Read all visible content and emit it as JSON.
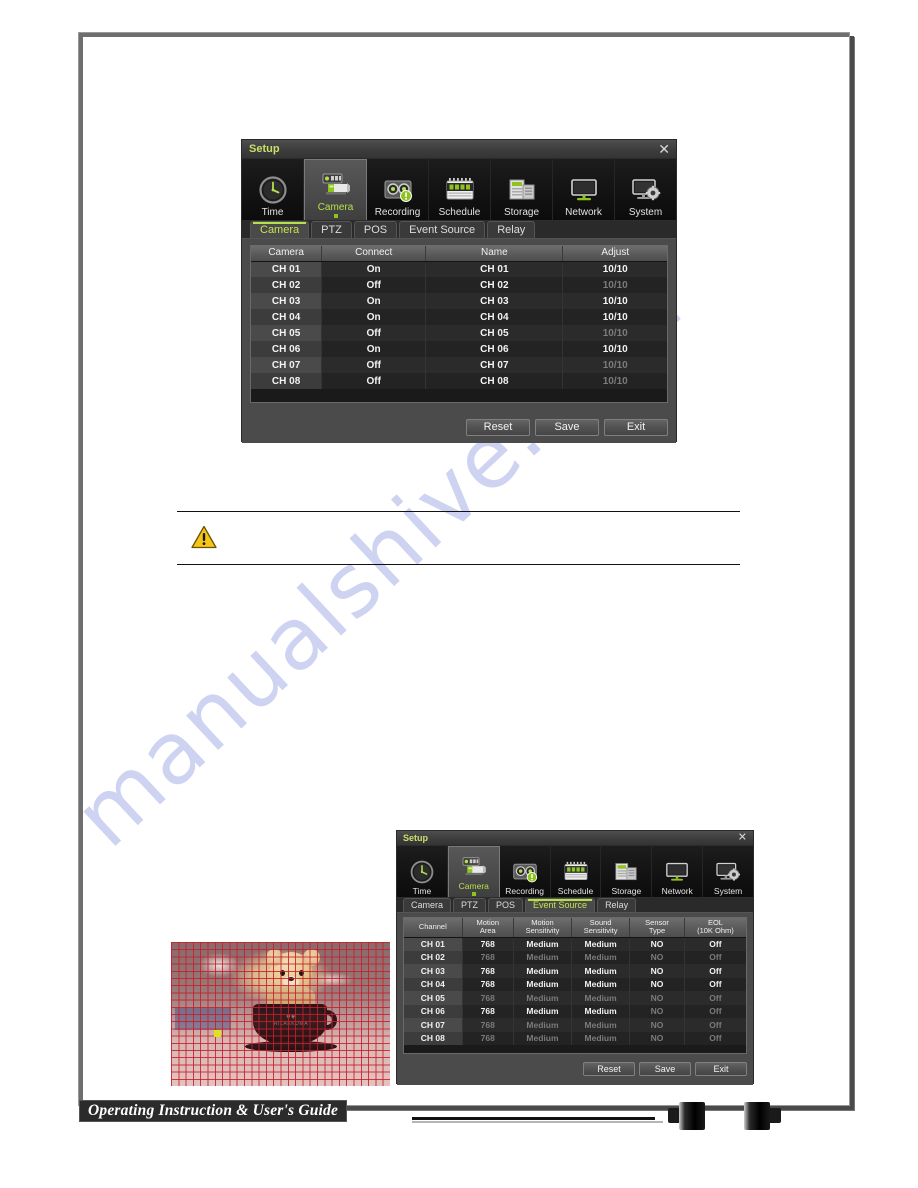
{
  "page": {
    "watermark": "manualshive.com"
  },
  "note": {
    "icon": "warning-triangle-icon",
    "text": ""
  },
  "dialog1": {
    "title": "Setup",
    "close_label": "✕",
    "nav": [
      {
        "label": "Time",
        "icon": "clock-icon",
        "active": false
      },
      {
        "label": "Camera",
        "icon": "camera-icon",
        "active": true
      },
      {
        "label": "Recording",
        "icon": "recording-icon",
        "active": false
      },
      {
        "label": "Schedule",
        "icon": "calendar-icon",
        "active": false
      },
      {
        "label": "Storage",
        "icon": "storage-icon",
        "active": false
      },
      {
        "label": "Network",
        "icon": "monitor-icon",
        "active": false
      },
      {
        "label": "System",
        "icon": "system-icon",
        "active": false
      }
    ],
    "subtabs": [
      {
        "label": "Camera",
        "active": true
      },
      {
        "label": "PTZ",
        "active": false
      },
      {
        "label": "POS",
        "active": false
      },
      {
        "label": "Event Source",
        "active": false
      },
      {
        "label": "Relay",
        "active": false
      }
    ],
    "table": {
      "columns": [
        "Camera",
        "Connect",
        "Name",
        "Adjust"
      ],
      "rows": [
        {
          "cells": [
            "CH 01",
            "On",
            "CH 01",
            "10/10"
          ],
          "enabled": true
        },
        {
          "cells": [
            "CH 02",
            "Off",
            "CH 02",
            "10/10"
          ],
          "enabled": false
        },
        {
          "cells": [
            "CH 03",
            "On",
            "CH 03",
            "10/10"
          ],
          "enabled": true
        },
        {
          "cells": [
            "CH 04",
            "On",
            "CH 04",
            "10/10"
          ],
          "enabled": true
        },
        {
          "cells": [
            "CH 05",
            "Off",
            "CH 05",
            "10/10"
          ],
          "enabled": false
        },
        {
          "cells": [
            "CH 06",
            "On",
            "CH 06",
            "10/10"
          ],
          "enabled": true
        },
        {
          "cells": [
            "CH 07",
            "Off",
            "CH 07",
            "10/10"
          ],
          "enabled": false
        },
        {
          "cells": [
            "CH 08",
            "Off",
            "CH 08",
            "10/10"
          ],
          "enabled": false
        }
      ]
    },
    "buttons": [
      {
        "label": "Reset"
      },
      {
        "label": "Save"
      },
      {
        "label": "Exit"
      }
    ]
  },
  "dialog2": {
    "title": "Setup",
    "close_label": "✕",
    "nav": [
      {
        "label": "Time",
        "icon": "clock-icon",
        "active": false
      },
      {
        "label": "Camera",
        "icon": "camera-icon",
        "active": true
      },
      {
        "label": "Recording",
        "icon": "recording-icon",
        "active": false
      },
      {
        "label": "Schedule",
        "icon": "calendar-icon",
        "active": false
      },
      {
        "label": "Storage",
        "icon": "storage-icon",
        "active": false
      },
      {
        "label": "Network",
        "icon": "monitor-icon",
        "active": false
      },
      {
        "label": "System",
        "icon": "system-icon",
        "active": false
      }
    ],
    "subtabs": [
      {
        "label": "Camera",
        "active": false
      },
      {
        "label": "PTZ",
        "active": false
      },
      {
        "label": "POS",
        "active": false
      },
      {
        "label": "Event Source",
        "active": true
      },
      {
        "label": "Relay",
        "active": false
      }
    ],
    "table": {
      "columns": [
        "Channel",
        "Motion\nArea",
        "Motion\nSensitivity",
        "Sound\nSensitivity",
        "Sensor\nType",
        "EOL\n(10K Ohm)"
      ],
      "rows": [
        {
          "cells": [
            "CH 01",
            "768",
            "Medium",
            "Medium",
            "NO",
            "Off"
          ],
          "enabled": true
        },
        {
          "cells": [
            "CH 02",
            "768",
            "Medium",
            "Medium",
            "NO",
            "Off"
          ],
          "enabled": false
        },
        {
          "cells": [
            "CH 03",
            "768",
            "Medium",
            "Medium",
            "NO",
            "Off"
          ],
          "enabled": true
        },
        {
          "cells": [
            "CH 04",
            "768",
            "Medium",
            "Medium",
            "NO",
            "Off"
          ],
          "enabled": true
        },
        {
          "cells": [
            "CH 05",
            "768",
            "Medium",
            "Medium",
            "NO",
            "Off"
          ],
          "enabled": false
        },
        {
          "cells": [
            "CH 06",
            "768",
            "Medium",
            "Medium",
            "NO",
            "Off"
          ],
          "enabled": true
        },
        {
          "cells": [
            "CH 07",
            "768",
            "Medium",
            "Medium",
            "NO",
            "Off"
          ],
          "enabled": false
        },
        {
          "cells": [
            "CH 08",
            "768",
            "Medium",
            "Medium",
            "NO",
            "Off"
          ],
          "enabled": false
        }
      ]
    },
    "buttons": [
      {
        "label": "Reset"
      },
      {
        "label": "Save"
      },
      {
        "label": "Exit"
      }
    ]
  },
  "camera_preview": {
    "logo_hearts": "♥♥",
    "logo_text": "RILAKKUMA"
  },
  "footer": {
    "banner": "Operating Instruction & User's Guide"
  },
  "colors": {
    "accent_green": "#b5e04a",
    "window_bg": "#4b4b4b",
    "table_bg": "#1a1a1a",
    "watermark": "#c6ccf0",
    "grid_red": "#c81e28",
    "selection_yellow": "#e2e21a"
  }
}
